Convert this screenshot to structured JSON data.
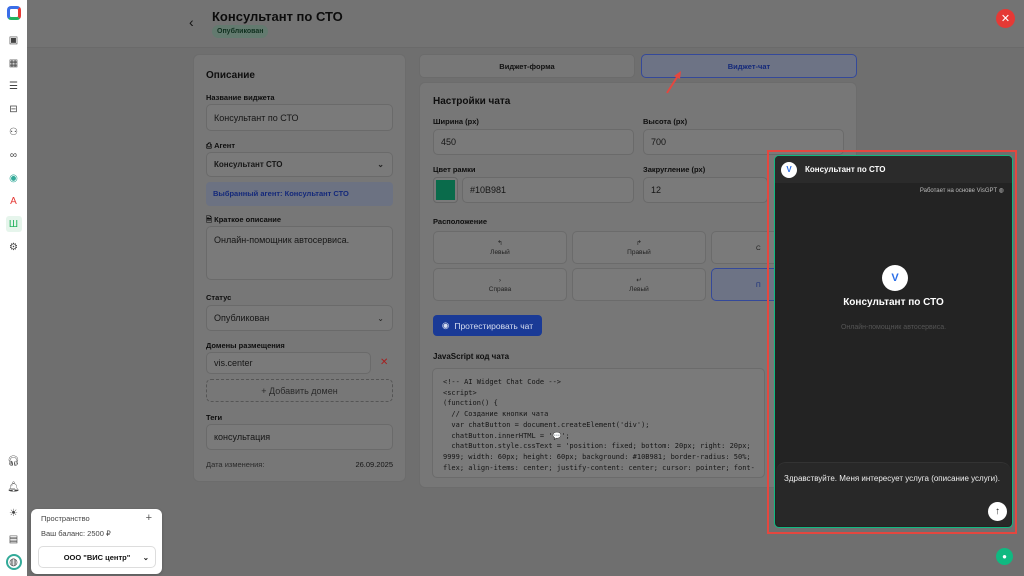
{
  "sidebar": {
    "icons": [
      "logo-icon",
      "dashboard-icon",
      "table-icon",
      "list-icon",
      "robot-icon",
      "users-icon",
      "infinity-icon",
      "apps-icon",
      "font-icon",
      "widget-icon",
      "settings-icon"
    ],
    "bottom_icons": [
      "headset-icon",
      "bell-icon",
      "sun-icon",
      "document-icon",
      "avatar-icon"
    ]
  },
  "header": {
    "title": "Консультант по СТО",
    "status_badge": "Опубликован"
  },
  "description": {
    "heading": "Описание",
    "name_label": "Название виджета",
    "name_value": "Консультант по СТО",
    "agent_label": "Агент",
    "agent_value": "Консультант СТО",
    "agent_note": "Выбранный агент: Консультант СТО",
    "short_label": "Краткое описание",
    "short_value": "Онлайн-помощник автосервиса.",
    "status_label": "Статус",
    "status_value": "Опубликован",
    "domains_label": "Домены размещения",
    "domain_value": "vis.center",
    "add_domain": "+ Добавить домен",
    "tags_label": "Теги",
    "tags_value": "консультация",
    "modified_label": "Дата изменения:",
    "modified_value": "26.09.2025"
  },
  "tabs": [
    {
      "label": "Виджет-форма",
      "active": false
    },
    {
      "label": "Виджет-чат",
      "active": true
    }
  ],
  "chat_settings": {
    "heading": "Настройки чата",
    "width_label": "Ширина (px)",
    "width_value": "450",
    "height_label": "Высота (px)",
    "height_value": "700",
    "color_label": "Цвет рамки",
    "color_value": "#10B981",
    "radius_label": "Закругление (px)",
    "radius_value": "12",
    "position_label": "Расположение",
    "positions": [
      {
        "icon": "↰",
        "label": "Левый"
      },
      {
        "icon": "↱",
        "label": "Правый"
      },
      {
        "icon": "",
        "label": "С"
      },
      {
        "icon": "›",
        "label": "Справа"
      },
      {
        "icon": "↵",
        "label": "Левый"
      },
      {
        "icon": "",
        "label": "П"
      }
    ],
    "test_button": "Протестировать чат",
    "code_label": "JavaScript код чата",
    "code": "<!-- AI Widget Chat Code -->\n<script>\n(function() {\n  // Создание кнопки чата\n  var chatButton = document.createElement('div');\n  chatButton.innerHTML = '💬';\n  chatButton.style.cssText = 'position: fixed; bottom: 20px; right: 20px;\n9999; width: 60px; height: 60px; background: #10B981; border-radius: 50%;\nflex; align-items: center; justify-content: center; cursor: pointer; font-"
  },
  "chat_preview": {
    "title": "Консультант по СТО",
    "powered": "Работает на основе VisGPT",
    "center_title": "Консультант по СТО",
    "center_sub": "Онлайн-помощник автосервиса.",
    "input_text": "Здравствуйте. Меня интересует услуга (описание услуги)."
  },
  "space": {
    "label": "Пространство",
    "balance": "Ваш баланс: 2500 ₽",
    "org": "ООО \"ВИС центр\""
  },
  "colors": {
    "accent": "#1e4fd8",
    "frame": "#10B981",
    "highlight": "#e4473f"
  }
}
